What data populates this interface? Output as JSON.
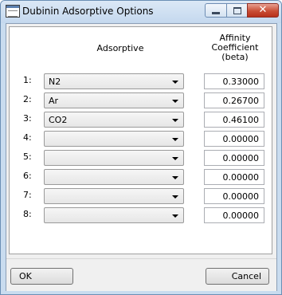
{
  "window": {
    "title": "Dubinin Adsorptive Options",
    "icon": "app-window-icon",
    "controls": {
      "minimize_icon": "minimize-icon",
      "maximize_icon": "maximize-icon",
      "close_symbol": "✕"
    }
  },
  "table": {
    "headers": {
      "adsorptive": "Adsorptive",
      "affinity_line1": "Affinity",
      "affinity_line2": "Coefficient",
      "affinity_line3": "(beta)"
    },
    "rows": [
      {
        "num": "1:",
        "adsorptive": "N2",
        "beta": "0.33000"
      },
      {
        "num": "2:",
        "adsorptive": "Ar",
        "beta": "0.26700"
      },
      {
        "num": "3:",
        "adsorptive": "CO2",
        "beta": "0.46100"
      },
      {
        "num": "4:",
        "adsorptive": "",
        "beta": "0.00000"
      },
      {
        "num": "5:",
        "adsorptive": "",
        "beta": "0.00000"
      },
      {
        "num": "6:",
        "adsorptive": "",
        "beta": "0.00000"
      },
      {
        "num": "7:",
        "adsorptive": "",
        "beta": "0.00000"
      },
      {
        "num": "8:",
        "adsorptive": "",
        "beta": "0.00000"
      }
    ]
  },
  "buttons": {
    "ok": "OK",
    "cancel": "Cancel"
  },
  "colors": {
    "close_button": "#c94e36",
    "titlebar": "#c4d8ee",
    "window_border": "#6b8fb5"
  }
}
